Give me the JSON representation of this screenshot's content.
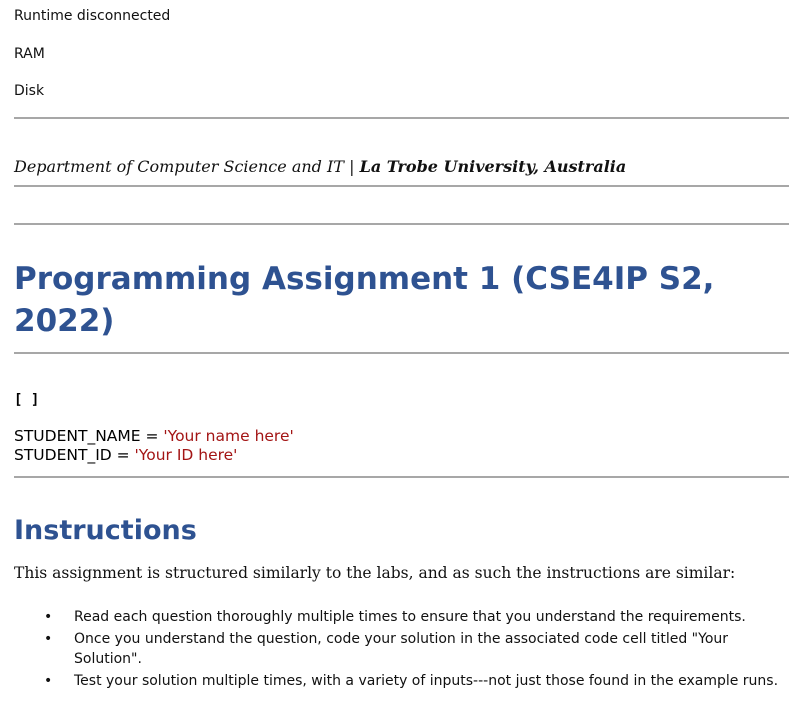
{
  "runtime": {
    "status": "Runtime disconnected",
    "ram_label": "RAM",
    "disk_label": "Disk"
  },
  "header": {
    "department": "Department of Computer Science and IT",
    "separator": "|",
    "university": "La Trobe University, Australia"
  },
  "title": "Programming Assignment 1 (CSE4IP S2, 2022)",
  "code_cell": {
    "prompt": "[ ]",
    "line1_var": "STUDENT_NAME = ",
    "line1_str": "'Your name here'",
    "line2_var": "STUDENT_ID = ",
    "line2_str": "'Your ID here'"
  },
  "instructions": {
    "heading": "Instructions",
    "intro": "This assignment is structured similarly to the labs, and as such the instructions are similar:",
    "items": [
      "Read each question thoroughly multiple times to ensure that you understand the requirements.",
      "Once you understand the question, code your solution in the associated code cell titled \"Your Solution\".",
      "Test your solution multiple times, with a variety of inputs---not just those found in the example runs."
    ]
  },
  "colors": {
    "heading": "#2e5291",
    "string": "#a31515",
    "rule": "#a7a7a7"
  }
}
